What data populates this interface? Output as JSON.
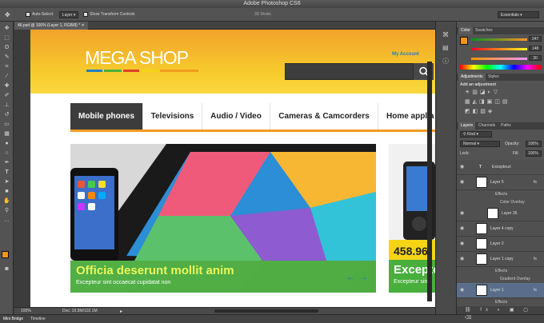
{
  "window": {
    "title": "Adobe Photoshop CS6"
  },
  "options": {
    "auto_select_label": "Auto-Select:",
    "auto_select_value": "Layer",
    "transform_label": "Show Transform Controls",
    "mode3d": "3D Mode:",
    "workspace": "Essentials"
  },
  "document": {
    "tab_label": "46.psd @ 100% (Layer 1, RGB/8) *",
    "zoom": "100%",
    "doc_size": "Doc: 10.5M/102.1M"
  },
  "site": {
    "logo": "MEGA SHOP",
    "account_link": "My Account",
    "nav": [
      "Mobile phones",
      "Televisions",
      "Audio / Video",
      "Cameras & Camcorders",
      "Home applia"
    ],
    "slide_title": "Officia deserunt mollit anim",
    "slide_sub": "Excepteur sint occaecat cupidatat non",
    "price": "458.96",
    "side_title": "Excepte",
    "side_sub": "Excepteur sint"
  },
  "panels": {
    "color_tabs": [
      "Color",
      "Swatches"
    ],
    "rgb": [
      "247",
      "148",
      "30"
    ],
    "adj_tabs": [
      "Adjustments",
      "Styles"
    ],
    "adj_heading": "Add an adjustment",
    "layer_tabs": [
      "Layers",
      "Channels",
      "Paths"
    ],
    "kind": "Kind",
    "blend": "Normal",
    "opacity_label": "Opacity:",
    "opacity": "100%",
    "lock_label": "Lock:",
    "fill_label": "Fill:",
    "fill": "100%",
    "layers": [
      {
        "name": "Excepteuri",
        "type": "text"
      },
      {
        "name": "Layer 5",
        "type": "px"
      },
      {
        "name": "Effects",
        "type": "sub"
      },
      {
        "name": "Color Overlay",
        "type": "sub2"
      },
      {
        "name": "Layer 36",
        "type": "px"
      },
      {
        "name": "Layer 4 copy",
        "type": "px"
      },
      {
        "name": "Layer 2",
        "type": "px"
      },
      {
        "name": "Layer 1 copy",
        "type": "px"
      },
      {
        "name": "Effects",
        "type": "sub"
      },
      {
        "name": "Gradient Overlay",
        "type": "sub2"
      },
      {
        "name": "Layer 1",
        "type": "px"
      },
      {
        "name": "Effects",
        "type": "sub"
      },
      {
        "name": "Gradient Overlay",
        "type": "sub2"
      }
    ]
  },
  "bottom_tabs": [
    "Mini Bridge",
    "Timeline"
  ],
  "colors": {
    "accent": "#f29c1f",
    "green": "#48ae3c",
    "yellow": "#f5d416",
    "active_nav": "#3c3c3c"
  }
}
